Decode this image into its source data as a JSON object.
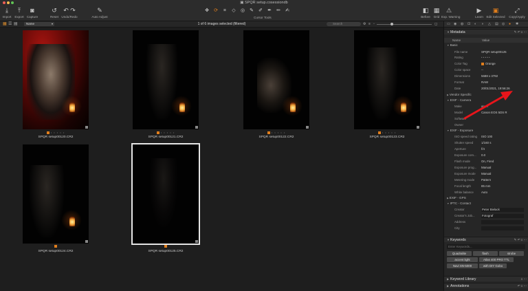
{
  "window": {
    "title": "SPQR setup.cosessiondb"
  },
  "toolbar": {
    "import": "Import",
    "export": "Export",
    "capture": "Capture",
    "reset": "Reset",
    "undo_redo": "Undo/Redo",
    "auto_adjust": "Auto Adjust",
    "cursor_tools": "Cursor Tools",
    "before": "Before",
    "grid": "Grid",
    "exp_warning": "Exp. Warning",
    "learn": "Learn",
    "edit_selected": "Edit Selected",
    "copy_apply": "Copy/Apply"
  },
  "browser": {
    "sort_value": "Name",
    "selection_status": "1 of 6 images selected (filtered)",
    "search_placeholder": "Search",
    "images": [
      {
        "filename": "SPQR setup00120.CR2",
        "selected": false
      },
      {
        "filename": "SPQR setup00121.CR2",
        "selected": false
      },
      {
        "filename": "SPQR setup00122.CR2",
        "selected": false
      },
      {
        "filename": "SPQR setup00123.CR2",
        "selected": false
      },
      {
        "filename": "SPQR setup00124.CR2",
        "selected": false
      },
      {
        "filename": "SPQR setup00125.CR2",
        "selected": true
      }
    ]
  },
  "inspector": {
    "metadata_title": "Metadata",
    "col_name": "Name",
    "col_value": "Value",
    "basic_group": "Basic",
    "basic": {
      "file_name_k": "File name",
      "file_name_v": "SPQR setup00125",
      "rating_k": "Rating",
      "rating_v": "• • • • •",
      "color_tag_k": "Color Tag",
      "color_tag_v": "Orange",
      "color_space_k": "Color space",
      "color_space_v": "--",
      "dimensions_k": "Dimensions",
      "dimensions_v": "5688 x 3792",
      "format_k": "Format",
      "format_v": "RAW",
      "date_k": "Date",
      "date_v": "20/01/2021, 19:56:26"
    },
    "vendor_group": "Vendor Specific",
    "exif_camera_group": "EXIF - Camera",
    "camera": {
      "make_k": "Make",
      "make_v": "anon",
      "model_k": "Model",
      "model_v": "Canon EOS 5DS R",
      "software_k": "Software",
      "owner_k": "Owner"
    },
    "exif_exposure_group": "EXIF - Exposure",
    "exposure": {
      "iso_k": "ISO speed rating",
      "iso_v": "ISO 100",
      "shutter_k": "Shutter speed",
      "shutter_v": "1/160 s",
      "aperture_k": "Aperture",
      "aperture_v": "f/4",
      "comp_k": "Exposure com...",
      "comp_v": "0.0",
      "flash_k": "Flash mode",
      "flash_v": "On, Fired",
      "prog_k": "Exposure prog...",
      "prog_v": "Manual",
      "mode_k": "Exposure mode",
      "mode_v": "Manual",
      "meter_k": "Metering mode",
      "meter_v": "Pattern",
      "focal_k": "Focal length",
      "focal_v": "85 mm",
      "wb_k": "White balance",
      "wb_v": "Auto"
    },
    "exif_gps_group": "EXIF - GPS",
    "iptc_group": "IPTC - Contact",
    "iptc": {
      "creator_k": "Creator",
      "creator_v": "Peter Bielack",
      "job_k": "Creator's Job...",
      "job_v": "Fotograf",
      "address_k": "Address",
      "city_k": "City"
    },
    "keywords_title": "Keywords",
    "keywords_placeholder": "Enter Keywords...",
    "keywords": [
      "Quadralite",
      "flash",
      "strobe",
      "accent light",
      "Atlas 400 PRO TTL",
      "Navi SN-5000",
      "with DIY Gobo"
    ],
    "keyword_library_title": "Keyword Library",
    "annotations_title": "Annotations"
  },
  "colors": {
    "accent": "#e07e1c",
    "arrow": "#e8151b",
    "selection_outline": "#e6e6e6"
  }
}
